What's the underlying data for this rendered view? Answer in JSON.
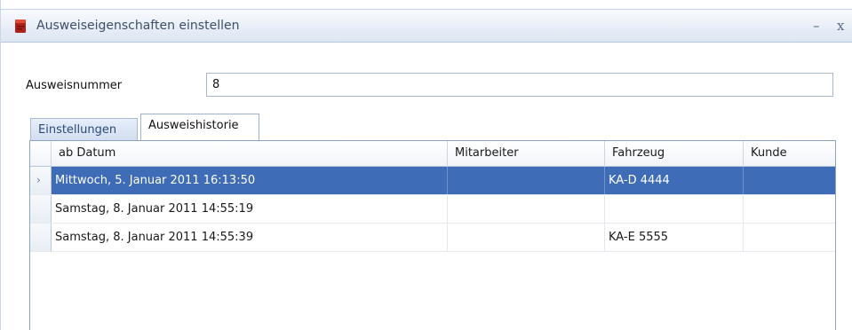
{
  "window": {
    "title": "Ausweiseigenschaften einstellen",
    "minimize_glyph": "–",
    "close_glyph": "x"
  },
  "form": {
    "ausweisnummer_label": "Ausweisnummer",
    "ausweisnummer_value": "8"
  },
  "tabs": [
    {
      "label": "Einstellungen",
      "active": false
    },
    {
      "label": "Ausweishistorie",
      "active": true
    }
  ],
  "grid": {
    "columns": [
      "ab Datum",
      "Mitarbeiter",
      "Fahrzeug",
      "Kunde"
    ],
    "rows": [
      {
        "date": "Mittwoch, 5. Januar 2011 16:13:50",
        "mitarbeiter": "",
        "fahrzeug": "KA-D 4444",
        "kunde": "",
        "selected": true
      },
      {
        "date": "Samstag, 8. Januar 2011 14:55:19",
        "mitarbeiter": "",
        "fahrzeug": "",
        "kunde": "",
        "selected": false
      },
      {
        "date": "Samstag, 8. Januar 2011 14:55:39",
        "mitarbeiter": "",
        "fahrzeug": "KA-E 5555",
        "kunde": "",
        "selected": false
      }
    ],
    "row_indicator_glyph": "›"
  },
  "colors": {
    "selection": "#3f6cb6",
    "titlebar": "#e8eef7",
    "grid_border": "#8ea3c2"
  },
  "icons": {
    "app": "red-card-icon"
  }
}
